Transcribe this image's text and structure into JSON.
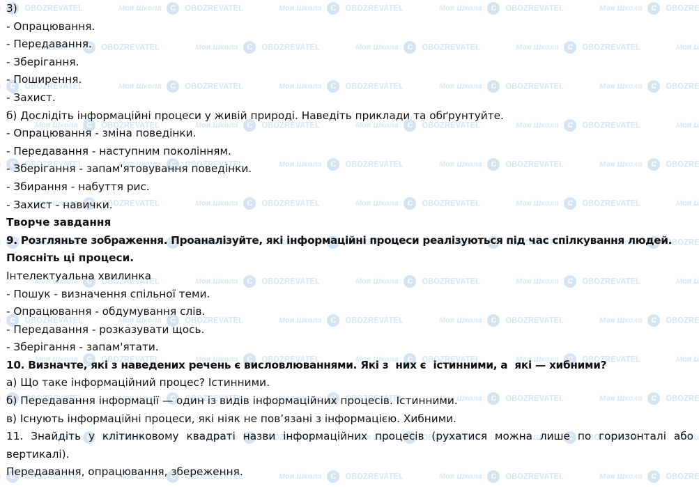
{
  "watermark": {
    "text_a": "Моя Школа",
    "text_b": "OBOZREVATEL",
    "logo_glyph": "С"
  },
  "lines": [
    "3)",
    "- Опрацювання.",
    "- Передавання.",
    "- Зберігання.",
    "- Поширення.",
    "- Захист.",
    "б) Дослідіть інформаційні процеси у живій природі. Наведіть приклади та обґрунтуйте.",
    "- Опрацювання - зміна поведінки.",
    "- Передавання - наступним поколінням.",
    "- Зберігання - запам'ятовування поведінки.",
    "- Збирання - набуття рис.",
    "- Захист - навички.",
    "Творче завдання",
    "9. Розгляньте зображення. Проаналізуйте, які інформаційні процеси реалізуються під час спілкування людей.",
    "Поясніть ці процеси.",
    "Інтелектуальна хвилинка",
    "- Пошук - визначення спільної теми.",
    "- Опрацювання - обдумування слів.",
    "- Передавання - розказувати щось.",
    "- Зберігання - запам'ятати.",
    "10. Визначте, які з наведених речень є висловлюваннями. Які з  них є  істинними, а  які — хибними?",
    "а) Що таке інформаційний процес? Істинними.",
    "б) Передавання інформації — один із видів інформаційних процесів. Істинними.",
    "в) Існують інформаційні процеси, які ніяк не пов’язані з інформацією. Хибними.",
    "11. Знайдіть у  клітинковому квадраті назви інформаційних процесів (рухатися можна лише по горизонталі або вертикалі).",
    "Передавання, опрацювання, збереження."
  ]
}
